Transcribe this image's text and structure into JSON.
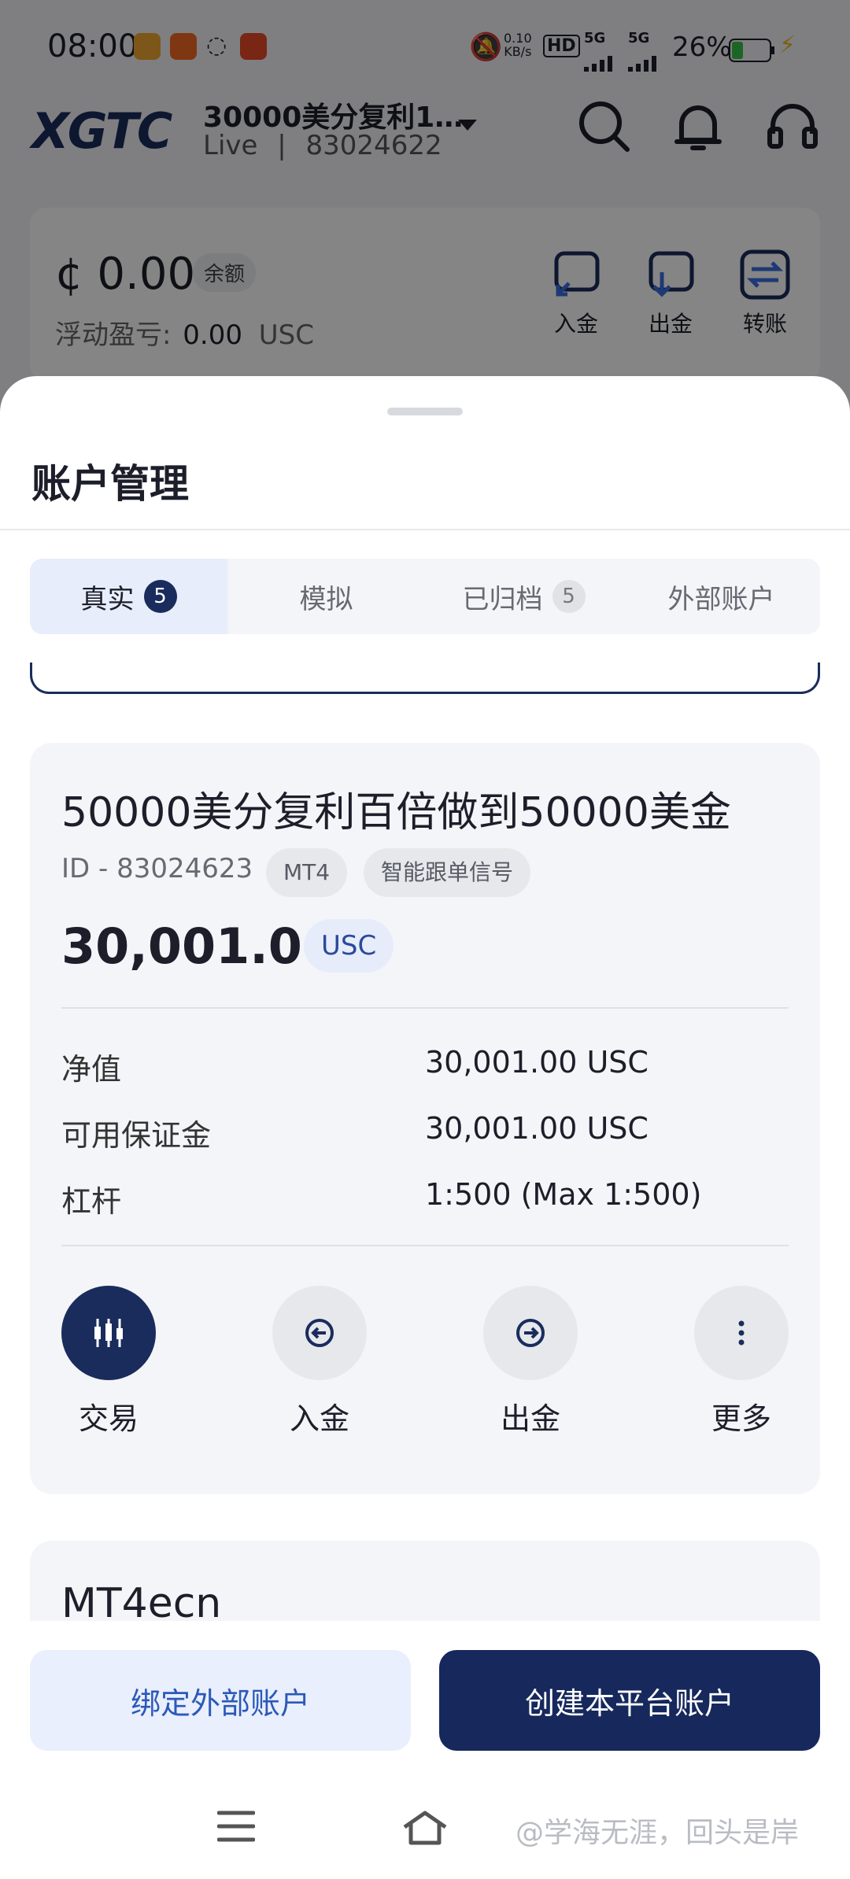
{
  "status_bar": {
    "time": "08:00",
    "net_speed_value": "0.10",
    "net_speed_unit": "KB/s",
    "hd": "HD",
    "sim1": "5G",
    "sim2": "5G",
    "battery": "26%"
  },
  "header": {
    "logo": "XGTC",
    "account_title": "30000美分复利1…",
    "account_sub_mode": "Live",
    "account_sub_sep": "|",
    "account_number": "83024622"
  },
  "balance": {
    "amount": "¢ 0.00",
    "tag": "余额",
    "floating_label": "浮动盈亏:",
    "floating_value": "0.00",
    "floating_unit": "USC",
    "actions": [
      "入金",
      "出金",
      "转账"
    ]
  },
  "sheet": {
    "title": "账户管理",
    "tabs": [
      {
        "label": "真实",
        "badge": "5"
      },
      {
        "label": "模拟",
        "badge": ""
      },
      {
        "label": "已归档",
        "badge": "5"
      },
      {
        "label": "外部账户",
        "badge": ""
      }
    ]
  },
  "account_card": {
    "name": "50000美分复利百倍做到50000美金",
    "id": "ID - 83024623",
    "platform": "MT4",
    "signal": "智能跟单信号",
    "balance": "30,001.00",
    "currency": "USC",
    "rows": [
      {
        "label": "净值",
        "value": "30,001.00 USC"
      },
      {
        "label": "可用保证金",
        "value": "30,001.00 USC"
      },
      {
        "label": "杠杆",
        "value": "1:500 (Max 1:500)"
      }
    ],
    "actions": [
      "交易",
      "入金",
      "出金",
      "更多"
    ]
  },
  "next_card": {
    "name": "MT4ecn"
  },
  "footer": {
    "bind_button": "绑定外部账户",
    "create_button": "创建本平台账户",
    "watermark": "@学海无涯，回头是岸"
  },
  "colors": {
    "brand_navy": "#1a2c5c",
    "accent_blue": "#2c59b8",
    "light_blue": "#e9effc"
  }
}
